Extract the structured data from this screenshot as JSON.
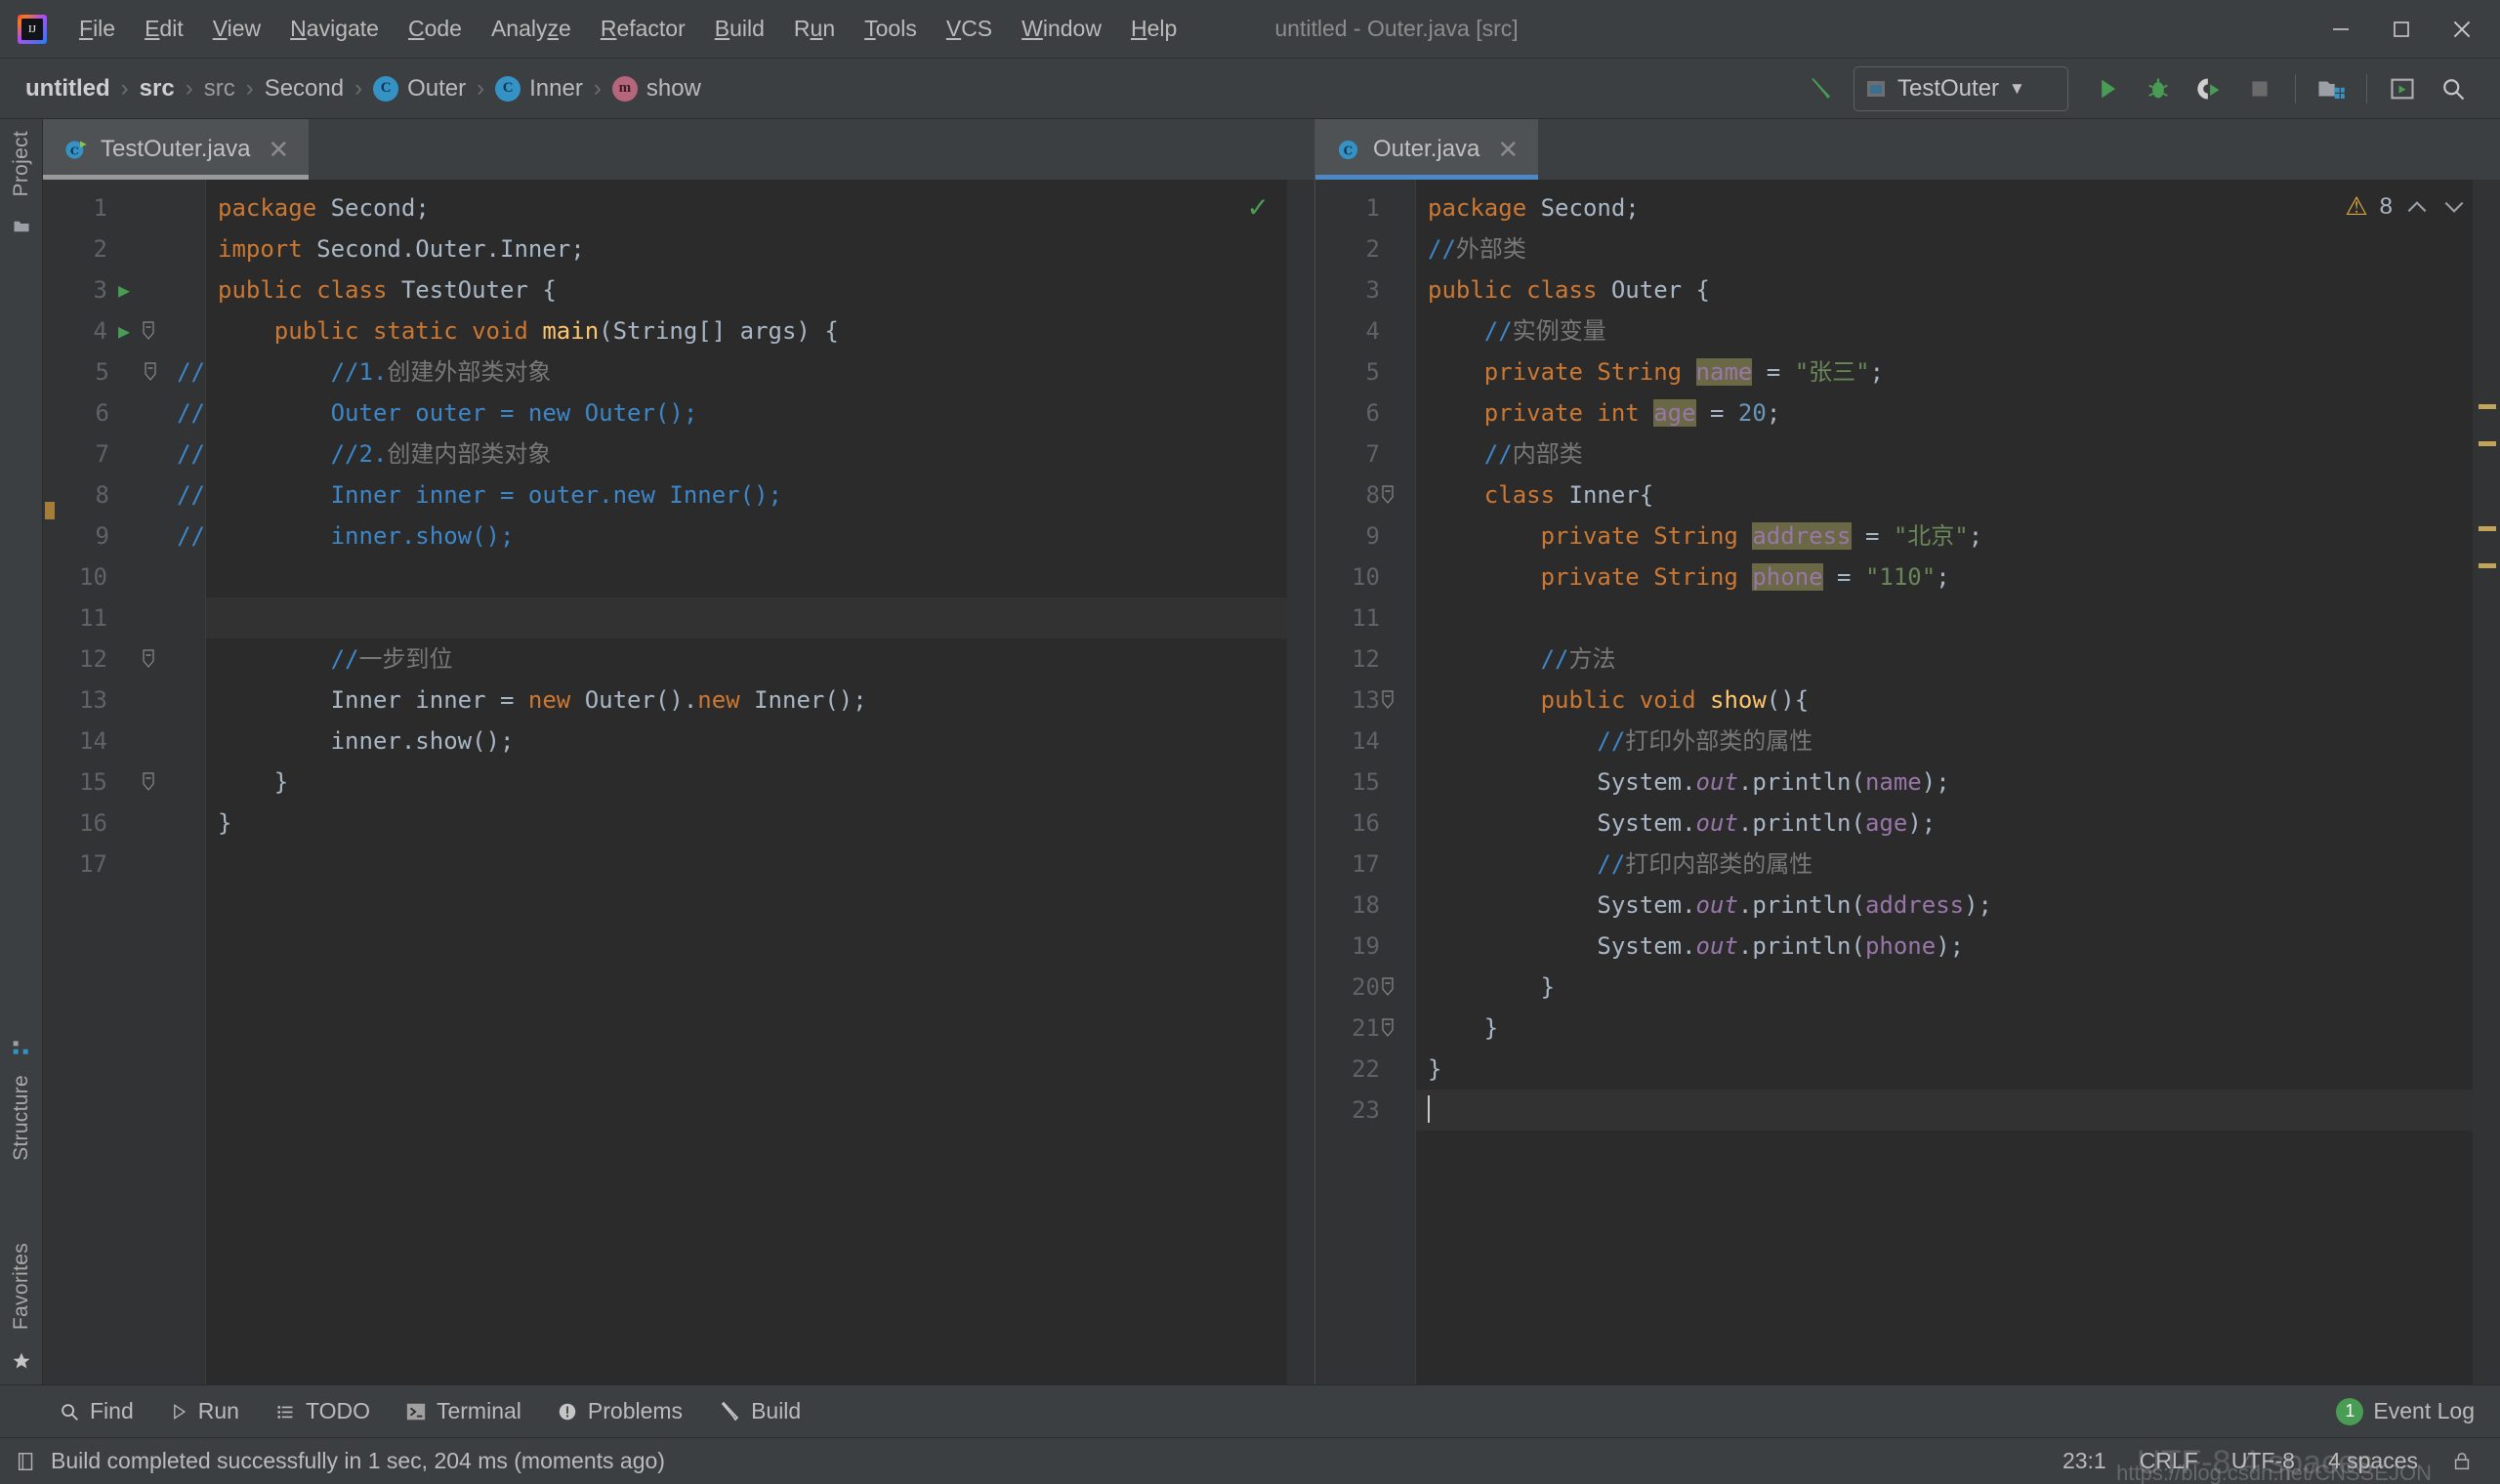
{
  "window": {
    "title": "untitled - Outer.java [src]",
    "logo_text": "IJ",
    "minimize": "—",
    "maximize": "❐",
    "close": "✕"
  },
  "menu": [
    {
      "label": "File",
      "mnemonic": "F"
    },
    {
      "label": "Edit",
      "mnemonic": "E"
    },
    {
      "label": "View",
      "mnemonic": "V"
    },
    {
      "label": "Navigate",
      "mnemonic": "N"
    },
    {
      "label": "Code",
      "mnemonic": "C"
    },
    {
      "label": "Analyze",
      "mnemonic": "z"
    },
    {
      "label": "Refactor",
      "mnemonic": "R"
    },
    {
      "label": "Build",
      "mnemonic": "B"
    },
    {
      "label": "Run",
      "mnemonic": "u"
    },
    {
      "label": "Tools",
      "mnemonic": "T"
    },
    {
      "label": "VCS",
      "mnemonic": "V"
    },
    {
      "label": "Window",
      "mnemonic": "W"
    },
    {
      "label": "Help",
      "mnemonic": "H"
    }
  ],
  "breadcrumbs": [
    {
      "label": "untitled",
      "style": "bold",
      "icon": ""
    },
    {
      "label": "src",
      "style": "bold",
      "icon": ""
    },
    {
      "label": "src",
      "style": "dim",
      "icon": ""
    },
    {
      "label": "Second",
      "style": "normal",
      "icon": ""
    },
    {
      "label": "Outer",
      "style": "normal",
      "icon": "class-icon"
    },
    {
      "label": "Inner",
      "style": "normal",
      "icon": "class-icon"
    },
    {
      "label": "show",
      "style": "normal",
      "icon": "method-icon"
    }
  ],
  "toolbar": {
    "build_icon": "hammer-icon",
    "run_config": "TestOuter",
    "run_config_icon": "application-icon",
    "dropdown_caret": "▼",
    "run_icon": "run-icon",
    "debug_icon": "debug-icon",
    "coverage_icon": "run-with-coverage-icon",
    "stop_icon": "stop-icon",
    "project_structure_icon": "project-structure-icon",
    "layout_icon": "layout-icon",
    "search_icon": "search-everywhere-icon"
  },
  "left_toolbar": {
    "top_items": [
      {
        "label": "Project",
        "icon": "project-icon"
      }
    ],
    "bottom_items": [
      {
        "label": "Structure",
        "icon": "structure-icon"
      },
      {
        "label": "Favorites",
        "icon": "favorites-star-icon"
      }
    ]
  },
  "panes": {
    "left": {
      "tab": {
        "label": "TestOuter.java",
        "icon": "java-runnable-class-icon",
        "close": "✕",
        "active": false
      },
      "inspection_ok": "✓",
      "total_lines": 17,
      "current_line": 11,
      "lines": [
        {
          "n": 1,
          "run": false,
          "fold": "",
          "tokens": [
            {
              "t": "package",
              "c": "kw"
            },
            {
              "t": " ",
              "c": "id"
            },
            {
              "t": "Second",
              "c": "id"
            },
            {
              "t": ";",
              "c": "id"
            }
          ]
        },
        {
          "n": 2,
          "run": false,
          "fold": "",
          "tokens": [
            {
              "t": "import",
              "c": "kw"
            },
            {
              "t": " Second.Outer.Inner;",
              "c": "id"
            }
          ]
        },
        {
          "n": 3,
          "run": true,
          "fold": "",
          "tokens": [
            {
              "t": "public class",
              "c": "kw"
            },
            {
              "t": " TestOuter {",
              "c": "id"
            }
          ]
        },
        {
          "n": 4,
          "run": true,
          "fold": "-",
          "tokens": [
            {
              "t": "    ",
              "c": "id"
            },
            {
              "t": "public static void",
              "c": "kw"
            },
            {
              "t": " ",
              "c": "id"
            },
            {
              "t": "main",
              "c": "mth"
            },
            {
              "t": "(String[] args) {",
              "c": "id"
            }
          ]
        },
        {
          "n": 5,
          "run": false,
          "fold": "-",
          "comment_marker": "//",
          "tokens": [
            {
              "t": "        //1.",
              "c": "cmtout"
            },
            {
              "t": "创建外部类对象",
              "c": "cmtoutcn"
            }
          ]
        },
        {
          "n": 6,
          "run": false,
          "fold": "",
          "comment_marker": "//",
          "tokens": [
            {
              "t": "        Outer outer = new Outer();",
              "c": "cmtout"
            }
          ]
        },
        {
          "n": 7,
          "run": false,
          "fold": "",
          "comment_marker": "//",
          "tokens": [
            {
              "t": "        //2.",
              "c": "cmtout"
            },
            {
              "t": "创建内部类对象",
              "c": "cmtoutcn"
            }
          ]
        },
        {
          "n": 8,
          "run": false,
          "fold": "",
          "comment_marker": "//",
          "tokens": [
            {
              "t": "        Inner inner = outer.new Inner();",
              "c": "cmtout"
            }
          ]
        },
        {
          "n": 9,
          "run": false,
          "fold": "",
          "comment_marker": "//",
          "tokens": [
            {
              "t": "        inner.show();",
              "c": "cmtout"
            }
          ]
        },
        {
          "n": 10,
          "run": false,
          "fold": "",
          "tokens": []
        },
        {
          "n": 11,
          "run": false,
          "fold": "",
          "tokens": []
        },
        {
          "n": 12,
          "run": false,
          "fold": "-",
          "tokens": [
            {
              "t": "        //",
              "c": "cmtout"
            },
            {
              "t": "一步到位",
              "c": "cmtoutcn"
            }
          ]
        },
        {
          "n": 13,
          "run": false,
          "fold": "",
          "tokens": [
            {
              "t": "        Inner inner = ",
              "c": "id"
            },
            {
              "t": "new",
              "c": "kw"
            },
            {
              "t": " Outer().",
              "c": "id"
            },
            {
              "t": "new",
              "c": "kw"
            },
            {
              "t": " Inner();",
              "c": "id"
            }
          ]
        },
        {
          "n": 14,
          "run": false,
          "fold": "",
          "tokens": [
            {
              "t": "        inner.show();",
              "c": "id"
            }
          ]
        },
        {
          "n": 15,
          "run": false,
          "fold": "-",
          "tokens": [
            {
              "t": "    }",
              "c": "id"
            }
          ]
        },
        {
          "n": 16,
          "run": false,
          "fold": "",
          "tokens": [
            {
              "t": "}",
              "c": "id"
            }
          ]
        },
        {
          "n": 17,
          "run": false,
          "fold": "",
          "tokens": []
        }
      ]
    },
    "right": {
      "tab": {
        "label": "Outer.java",
        "icon": "java-class-icon",
        "close": "✕",
        "active": true
      },
      "warning_icon": "warning-triangle-icon",
      "warning_count": "8",
      "nav_up": "⌃",
      "nav_down": "⌄",
      "total_lines": 23,
      "current_line": 23,
      "lines": [
        {
          "n": 1,
          "fold": "",
          "tokens": [
            {
              "t": "package",
              "c": "kw"
            },
            {
              "t": " Second;",
              "c": "id"
            }
          ]
        },
        {
          "n": 2,
          "fold": "",
          "tokens": [
            {
              "t": "//",
              "c": "cmtout"
            },
            {
              "t": "外部类",
              "c": "cmtoutcn"
            }
          ]
        },
        {
          "n": 3,
          "fold": "",
          "tokens": [
            {
              "t": "public class",
              "c": "kw"
            },
            {
              "t": " Outer {",
              "c": "id"
            }
          ]
        },
        {
          "n": 4,
          "fold": "",
          "tokens": [
            {
              "t": "    //",
              "c": "cmtout"
            },
            {
              "t": "实例变量",
              "c": "cmtoutcn"
            }
          ]
        },
        {
          "n": 5,
          "fold": "",
          "tokens": [
            {
              "t": "    ",
              "c": "id"
            },
            {
              "t": "private String",
              "c": "kw"
            },
            {
              "t": " ",
              "c": "id"
            },
            {
              "t": "name",
              "c": "fldhl"
            },
            {
              "t": " = ",
              "c": "id"
            },
            {
              "t": "\"张三\"",
              "c": "str"
            },
            {
              "t": ";",
              "c": "id"
            }
          ]
        },
        {
          "n": 6,
          "fold": "",
          "tokens": [
            {
              "t": "    ",
              "c": "id"
            },
            {
              "t": "private int",
              "c": "kw"
            },
            {
              "t": " ",
              "c": "id"
            },
            {
              "t": "age",
              "c": "fldhl"
            },
            {
              "t": " = ",
              "c": "id"
            },
            {
              "t": "20",
              "c": "num"
            },
            {
              "t": ";",
              "c": "id"
            }
          ]
        },
        {
          "n": 7,
          "fold": "",
          "tokens": [
            {
              "t": "    //",
              "c": "cmtout"
            },
            {
              "t": "内部类",
              "c": "cmtoutcn"
            }
          ]
        },
        {
          "n": 8,
          "fold": "-",
          "tokens": [
            {
              "t": "    ",
              "c": "id"
            },
            {
              "t": "class",
              "c": "kw"
            },
            {
              "t": " Inner{",
              "c": "id"
            }
          ]
        },
        {
          "n": 9,
          "fold": "",
          "tokens": [
            {
              "t": "        ",
              "c": "id"
            },
            {
              "t": "private String",
              "c": "kw"
            },
            {
              "t": " ",
              "c": "id"
            },
            {
              "t": "address",
              "c": "fldhl"
            },
            {
              "t": " = ",
              "c": "id"
            },
            {
              "t": "\"北京\"",
              "c": "str"
            },
            {
              "t": ";",
              "c": "id"
            }
          ]
        },
        {
          "n": 10,
          "fold": "",
          "tokens": [
            {
              "t": "        ",
              "c": "id"
            },
            {
              "t": "private String",
              "c": "kw"
            },
            {
              "t": " ",
              "c": "id"
            },
            {
              "t": "phone",
              "c": "fldhl"
            },
            {
              "t": " = ",
              "c": "id"
            },
            {
              "t": "\"110\"",
              "c": "str"
            },
            {
              "t": ";",
              "c": "id"
            }
          ]
        },
        {
          "n": 11,
          "fold": "",
          "tokens": []
        },
        {
          "n": 12,
          "fold": "",
          "tokens": [
            {
              "t": "        //",
              "c": "cmtout"
            },
            {
              "t": "方法",
              "c": "cmtoutcn"
            }
          ]
        },
        {
          "n": 13,
          "fold": "-",
          "tokens": [
            {
              "t": "        ",
              "c": "id"
            },
            {
              "t": "public void",
              "c": "kw"
            },
            {
              "t": " ",
              "c": "id"
            },
            {
              "t": "show",
              "c": "mth"
            },
            {
              "t": "(){",
              "c": "id"
            }
          ]
        },
        {
          "n": 14,
          "fold": "",
          "tokens": [
            {
              "t": "            //",
              "c": "cmtout"
            },
            {
              "t": "打印外部类的属性",
              "c": "cmtoutcn"
            }
          ]
        },
        {
          "n": 15,
          "fold": "",
          "tokens": [
            {
              "t": "            System.",
              "c": "id"
            },
            {
              "t": "out",
              "c": "stat"
            },
            {
              "t": ".println(",
              "c": "id"
            },
            {
              "t": "name",
              "c": "fld"
            },
            {
              "t": ");",
              "c": "id"
            }
          ]
        },
        {
          "n": 16,
          "fold": "",
          "tokens": [
            {
              "t": "            System.",
              "c": "id"
            },
            {
              "t": "out",
              "c": "stat"
            },
            {
              "t": ".println(",
              "c": "id"
            },
            {
              "t": "age",
              "c": "fld"
            },
            {
              "t": ");",
              "c": "id"
            }
          ]
        },
        {
          "n": 17,
          "fold": "",
          "tokens": [
            {
              "t": "            //",
              "c": "cmtout"
            },
            {
              "t": "打印内部类的属性",
              "c": "cmtoutcn"
            }
          ]
        },
        {
          "n": 18,
          "fold": "",
          "tokens": [
            {
              "t": "            System.",
              "c": "id"
            },
            {
              "t": "out",
              "c": "stat"
            },
            {
              "t": ".println(",
              "c": "id"
            },
            {
              "t": "address",
              "c": "fld"
            },
            {
              "t": ");",
              "c": "id"
            }
          ]
        },
        {
          "n": 19,
          "fold": "",
          "tokens": [
            {
              "t": "            System.",
              "c": "id"
            },
            {
              "t": "out",
              "c": "stat"
            },
            {
              "t": ".println(",
              "c": "id"
            },
            {
              "t": "phone",
              "c": "fld"
            },
            {
              "t": ");",
              "c": "id"
            }
          ]
        },
        {
          "n": 20,
          "fold": "-",
          "tokens": [
            {
              "t": "        }",
              "c": "id"
            }
          ]
        },
        {
          "n": 21,
          "fold": "-",
          "tokens": [
            {
              "t": "    }",
              "c": "id"
            }
          ]
        },
        {
          "n": 22,
          "fold": "",
          "tokens": [
            {
              "t": "}",
              "c": "id"
            }
          ]
        },
        {
          "n": 23,
          "fold": "",
          "caret": true,
          "tokens": []
        }
      ]
    }
  },
  "bottom_bar": [
    {
      "label": "Find",
      "icon": "search-icon"
    },
    {
      "label": "Run",
      "icon": "run-icon"
    },
    {
      "label": "TODO",
      "icon": "todo-list-icon"
    },
    {
      "label": "Terminal",
      "icon": "terminal-icon"
    },
    {
      "label": "Problems",
      "icon": "problems-icon"
    },
    {
      "label": "Build",
      "icon": "build-hammer-icon"
    }
  ],
  "event_log": {
    "count": "1",
    "label": "Event Log"
  },
  "status": {
    "message": "Build completed successfully in 1 sec, 204 ms (moments ago)",
    "message_icon": "build-status-icon",
    "caret_position": "23:1",
    "line_separator": "CRLF",
    "encoding": "UTF-8",
    "indent": "4 spaces",
    "watermark": "https://blog.csdn.net/CNSSEJON",
    "watermark_big": "UTF-8 4 spaces",
    "lock_icon": "read-only-toggle-icon"
  },
  "colors": {
    "background": "#2b2b2b",
    "chrome": "#3c3f41",
    "accent": "#4a88c7",
    "keyword": "#cc7832",
    "string": "#6a8759",
    "number": "#6897bb",
    "field": "#9876aa",
    "method": "#ffc66d",
    "comment_out": "#3d86c8",
    "warning": "#d9a343",
    "success": "#499c54"
  }
}
